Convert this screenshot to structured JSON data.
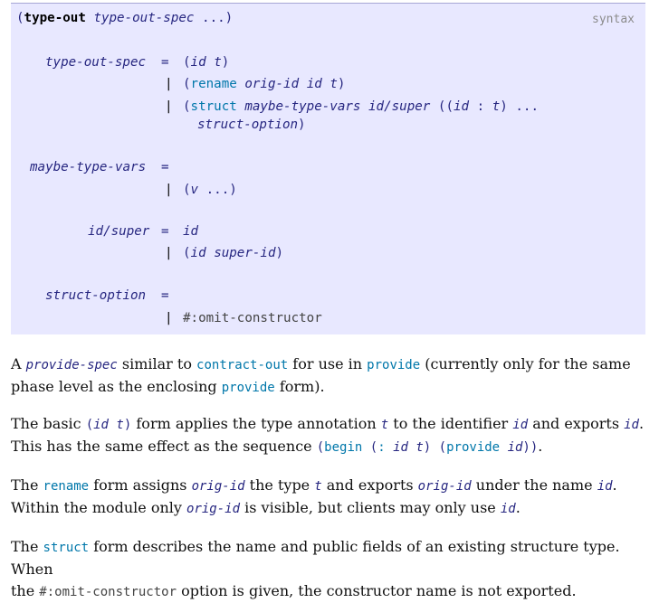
{
  "form_header": {
    "open": "(",
    "name": "type-out",
    "arg": "type-out-spec",
    "ellipsis": "...",
    "close": ")",
    "syntax_label": "syntax"
  },
  "grammar": {
    "eq": "=",
    "bar": "|",
    "type_out_spec": {
      "lhs": "type-out-spec",
      "alt1": {
        "open": "(",
        "id": "id",
        "t": "t",
        "close": ")"
      },
      "alt2": {
        "open": "(",
        "kw": "rename",
        "a": "orig-id",
        "b": "id",
        "c": "t",
        "close": ")"
      },
      "alt3": {
        "open": "(",
        "kw": "struct",
        "a": "maybe-type-vars",
        "b": "id/super",
        "inner_open": "((",
        "c": "id",
        "colon": ":",
        "d": "t",
        "inner_close": ")",
        "ellipsis": "...",
        "e": "struct-option",
        "close": ")"
      }
    },
    "maybe_type_vars": {
      "lhs": "maybe-type-vars",
      "alt1": {
        "open": "(",
        "v": "v",
        "ellipsis": "...",
        "close": ")"
      }
    },
    "id_super": {
      "lhs": "id/super",
      "alt1": "id",
      "alt2": {
        "open": "(",
        "a": "id",
        "b": "super-id",
        "close": ")"
      }
    },
    "struct_option": {
      "lhs": "struct-option",
      "alt1": "#:omit-constructor"
    }
  },
  "paragraphs": {
    "p1": {
      "t1": "A ",
      "v1": "provide-spec",
      "t2": " similar to ",
      "k1": "contract-out",
      "t3": " for use in ",
      "k2": "provide",
      "t4": " (currently only for the same",
      "t5": "phase level as the enclosing ",
      "k3": "provide",
      "t6": " form)."
    },
    "p2": {
      "t1": "The basic ",
      "c_open": "(",
      "c_id": "id",
      "c_t": "t",
      "c_close": ")",
      "t2": " form applies the type annotation ",
      "v_t": "t",
      "t3": " to the identifier ",
      "v_id": "id",
      "t4": " and exports ",
      "v_id2": "id",
      "t5": ".",
      "t6": "This has the same effect as the sequence ",
      "s_open": "(",
      "s_begin": "begin",
      "s_open2": "(",
      "s_colon": ":",
      "s_id": "id",
      "s_t": "t",
      "s_close": ")",
      "s_open3": "(",
      "s_provide": "provide",
      "s_id2": "id",
      "s_close2": "))",
      "t7": "."
    },
    "p3": {
      "t1": "The ",
      "k1": "rename",
      "t2": " form assigns ",
      "v1": "orig-id",
      "t3": " the type ",
      "v2": "t",
      "t4": " and exports ",
      "v3": "orig-id",
      "t5": " under the name ",
      "v4": "id",
      "t6": ".",
      "t7": "Within the module only ",
      "v5": "orig-id",
      "t8": " is visible, but clients may only use ",
      "v6": "id",
      "t9": "."
    },
    "p4": {
      "t1": "The ",
      "k1": "struct",
      "t2": " form describes the name and public fields of an existing structure type. When",
      "t3": "the ",
      "c1": "#:omit-constructor",
      "t4": " option is given, the constructor name is not exported."
    }
  }
}
